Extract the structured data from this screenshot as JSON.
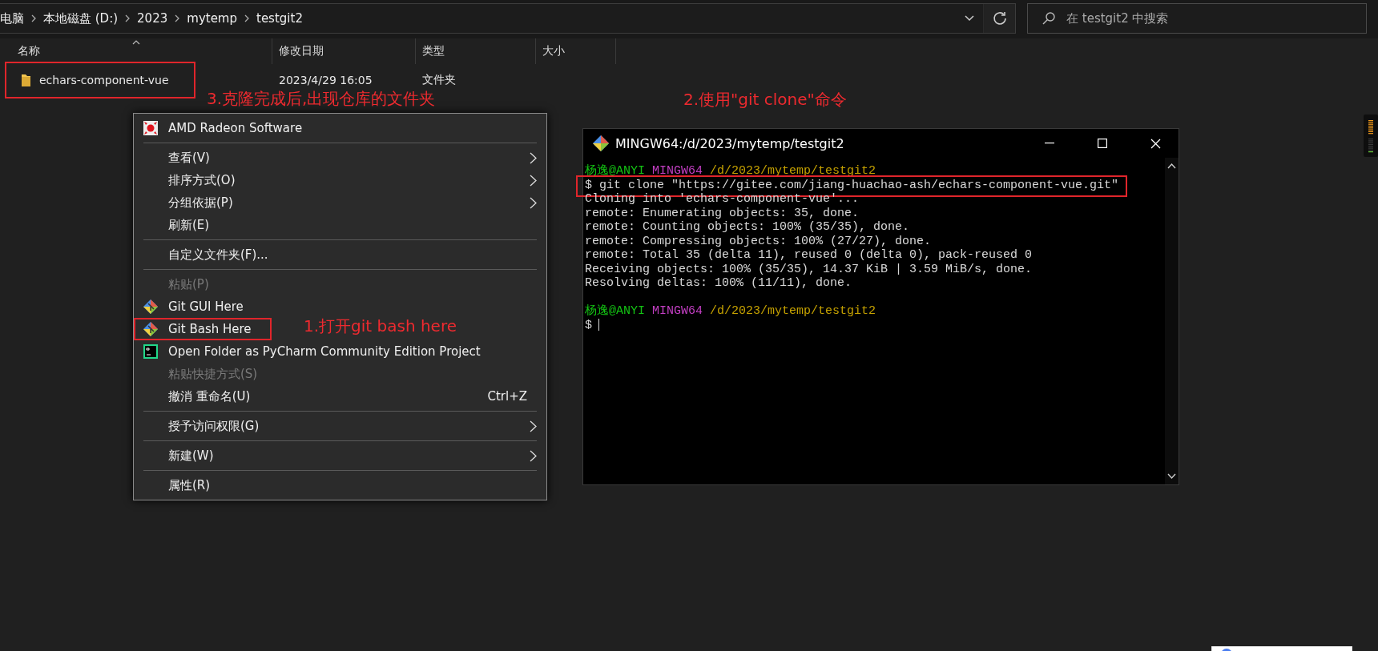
{
  "address_bar": {
    "breadcrumbs": [
      "电脑",
      "本地磁盘 (D:)",
      "2023",
      "mytemp",
      "testgit2"
    ]
  },
  "search": {
    "placeholder": "在 testgit2 中搜索"
  },
  "columns": [
    {
      "label": "名称",
      "sorted": true
    },
    {
      "label": "修改日期",
      "sorted": false
    },
    {
      "label": "类型",
      "sorted": false
    },
    {
      "label": "大小",
      "sorted": false
    }
  ],
  "files": [
    {
      "name": "echars-component-vue",
      "date": "2023/4/29 16:05",
      "type": "文件夹",
      "highlighted": true
    }
  ],
  "context_menu": {
    "items": [
      {
        "kind": "item",
        "label": "AMD Radeon Software",
        "disabled": false,
        "submenu": false,
        "highlighted": false
      },
      {
        "kind": "separator"
      },
      {
        "kind": "item",
        "label": "查看(V)",
        "disabled": false,
        "submenu": true,
        "highlighted": false
      },
      {
        "kind": "item",
        "label": "排序方式(O)",
        "disabled": false,
        "submenu": true,
        "highlighted": false
      },
      {
        "kind": "item",
        "label": "分组依据(P)",
        "disabled": false,
        "submenu": true,
        "highlighted": false
      },
      {
        "kind": "item",
        "label": "刷新(E)",
        "disabled": false,
        "submenu": false,
        "highlighted": false
      },
      {
        "kind": "separator"
      },
      {
        "kind": "item",
        "label": "自定义文件夹(F)...",
        "disabled": false,
        "submenu": false,
        "highlighted": false
      },
      {
        "kind": "separator"
      },
      {
        "kind": "item",
        "label": "粘贴(P)",
        "disabled": true,
        "submenu": false,
        "highlighted": false
      },
      {
        "kind": "item",
        "label": "Git GUI Here",
        "disabled": false,
        "submenu": false,
        "highlighted": false
      },
      {
        "kind": "item",
        "label": "Git Bash Here",
        "disabled": false,
        "submenu": false,
        "highlighted": true
      },
      {
        "kind": "item",
        "label": "Open Folder as PyCharm Community Edition Project",
        "disabled": false,
        "submenu": false,
        "highlighted": false
      },
      {
        "kind": "item",
        "label": "粘贴快捷方式(S)",
        "disabled": true,
        "submenu": false,
        "highlighted": false
      },
      {
        "kind": "item",
        "label": "撤消 重命名(U)",
        "shortcut": "Ctrl+Z",
        "disabled": false,
        "submenu": false,
        "highlighted": false
      },
      {
        "kind": "separator"
      },
      {
        "kind": "item",
        "label": "授予访问权限(G)",
        "disabled": false,
        "submenu": true,
        "highlighted": false
      },
      {
        "kind": "separator"
      },
      {
        "kind": "item",
        "label": "新建(W)",
        "disabled": false,
        "submenu": true,
        "highlighted": false
      },
      {
        "kind": "separator"
      },
      {
        "kind": "item",
        "label": "属性(R)",
        "disabled": false,
        "submenu": false,
        "highlighted": false
      }
    ]
  },
  "terminal": {
    "title": "MINGW64:/d/2023/mytemp/testgit2",
    "lines": [
      {
        "kind": "prompt",
        "user": "杨逸@ANYI",
        "system": "MINGW64",
        "path": "/d/2023/mytemp/testgit2"
      },
      {
        "kind": "output",
        "text": "$ git clone \"https://gitee.com/jiang-huachao-ash/echars-component-vue.git\"",
        "highlighted": true
      },
      {
        "kind": "output",
        "text": "Cloning into 'echars-component-vue'...",
        "highlighted": false
      },
      {
        "kind": "output",
        "text": "remote: Enumerating objects: 35, done.",
        "highlighted": false
      },
      {
        "kind": "output",
        "text": "remote: Counting objects: 100% (35/35), done.",
        "highlighted": false
      },
      {
        "kind": "output",
        "text": "remote: Compressing objects: 100% (27/27), done.",
        "highlighted": false
      },
      {
        "kind": "output",
        "text": "remote: Total 35 (delta 11), reused 0 (delta 0), pack-reused 0",
        "highlighted": false
      },
      {
        "kind": "output",
        "text": "Receiving objects: 100% (35/35), 14.37 KiB | 3.59 MiB/s, done.",
        "highlighted": false
      },
      {
        "kind": "output",
        "text": "Resolving deltas: 100% (11/11), done.",
        "highlighted": false
      },
      {
        "kind": "blank"
      },
      {
        "kind": "prompt",
        "user": "杨逸@ANYI",
        "system": "MINGW64",
        "path": "/d/2023/mytemp/testgit2"
      },
      {
        "kind": "input",
        "text": "$"
      }
    ]
  },
  "annotations": [
    {
      "text": "3.克隆完成后,出现仓库的文件夹"
    },
    {
      "text": "2.使用\"git clone\"命令"
    },
    {
      "text": "1.打开git bash here"
    }
  ]
}
